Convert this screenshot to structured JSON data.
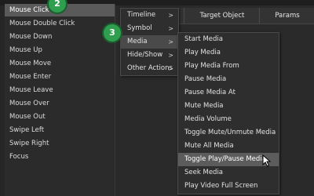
{
  "events": [
    "Mouse Click",
    "Mouse Double Click",
    "Mouse Down",
    "Mouse Up",
    "Mouse Move",
    "Mouse Enter",
    "Mouse Leave",
    "Mouse Over",
    "Mouse Out",
    "Swipe Left",
    "Swipe Right",
    "Focus"
  ],
  "selected_event": "Mouse Click",
  "grid": {
    "col_target": "Target Object",
    "col_params": "Params"
  },
  "submenu": {
    "items": [
      "Timeline",
      "Symbol",
      "Media",
      "Hide/Show",
      "Other Actions"
    ],
    "active": "Media"
  },
  "media_menu": {
    "items": [
      "Start Media",
      "Play Media",
      "Play Media From",
      "Pause Media",
      "Pause Media At",
      "Mute Media",
      "Media Volume",
      "Toggle Mute/Unmute Media",
      "Mute All Media",
      "Toggle Play/Pause Media",
      "Seek Media",
      "Play Video Full Screen"
    ],
    "hovered": "Toggle Play/Pause Media"
  },
  "callouts": {
    "step2": "2",
    "step3": "3"
  },
  "colors": {
    "badge_green": "#2f9e4f",
    "background": "#262626",
    "selected_row": "#5a5a5a"
  },
  "icons": {
    "arrow": "chevron-right-icon",
    "cursor": "mouse-pointer-icon"
  }
}
